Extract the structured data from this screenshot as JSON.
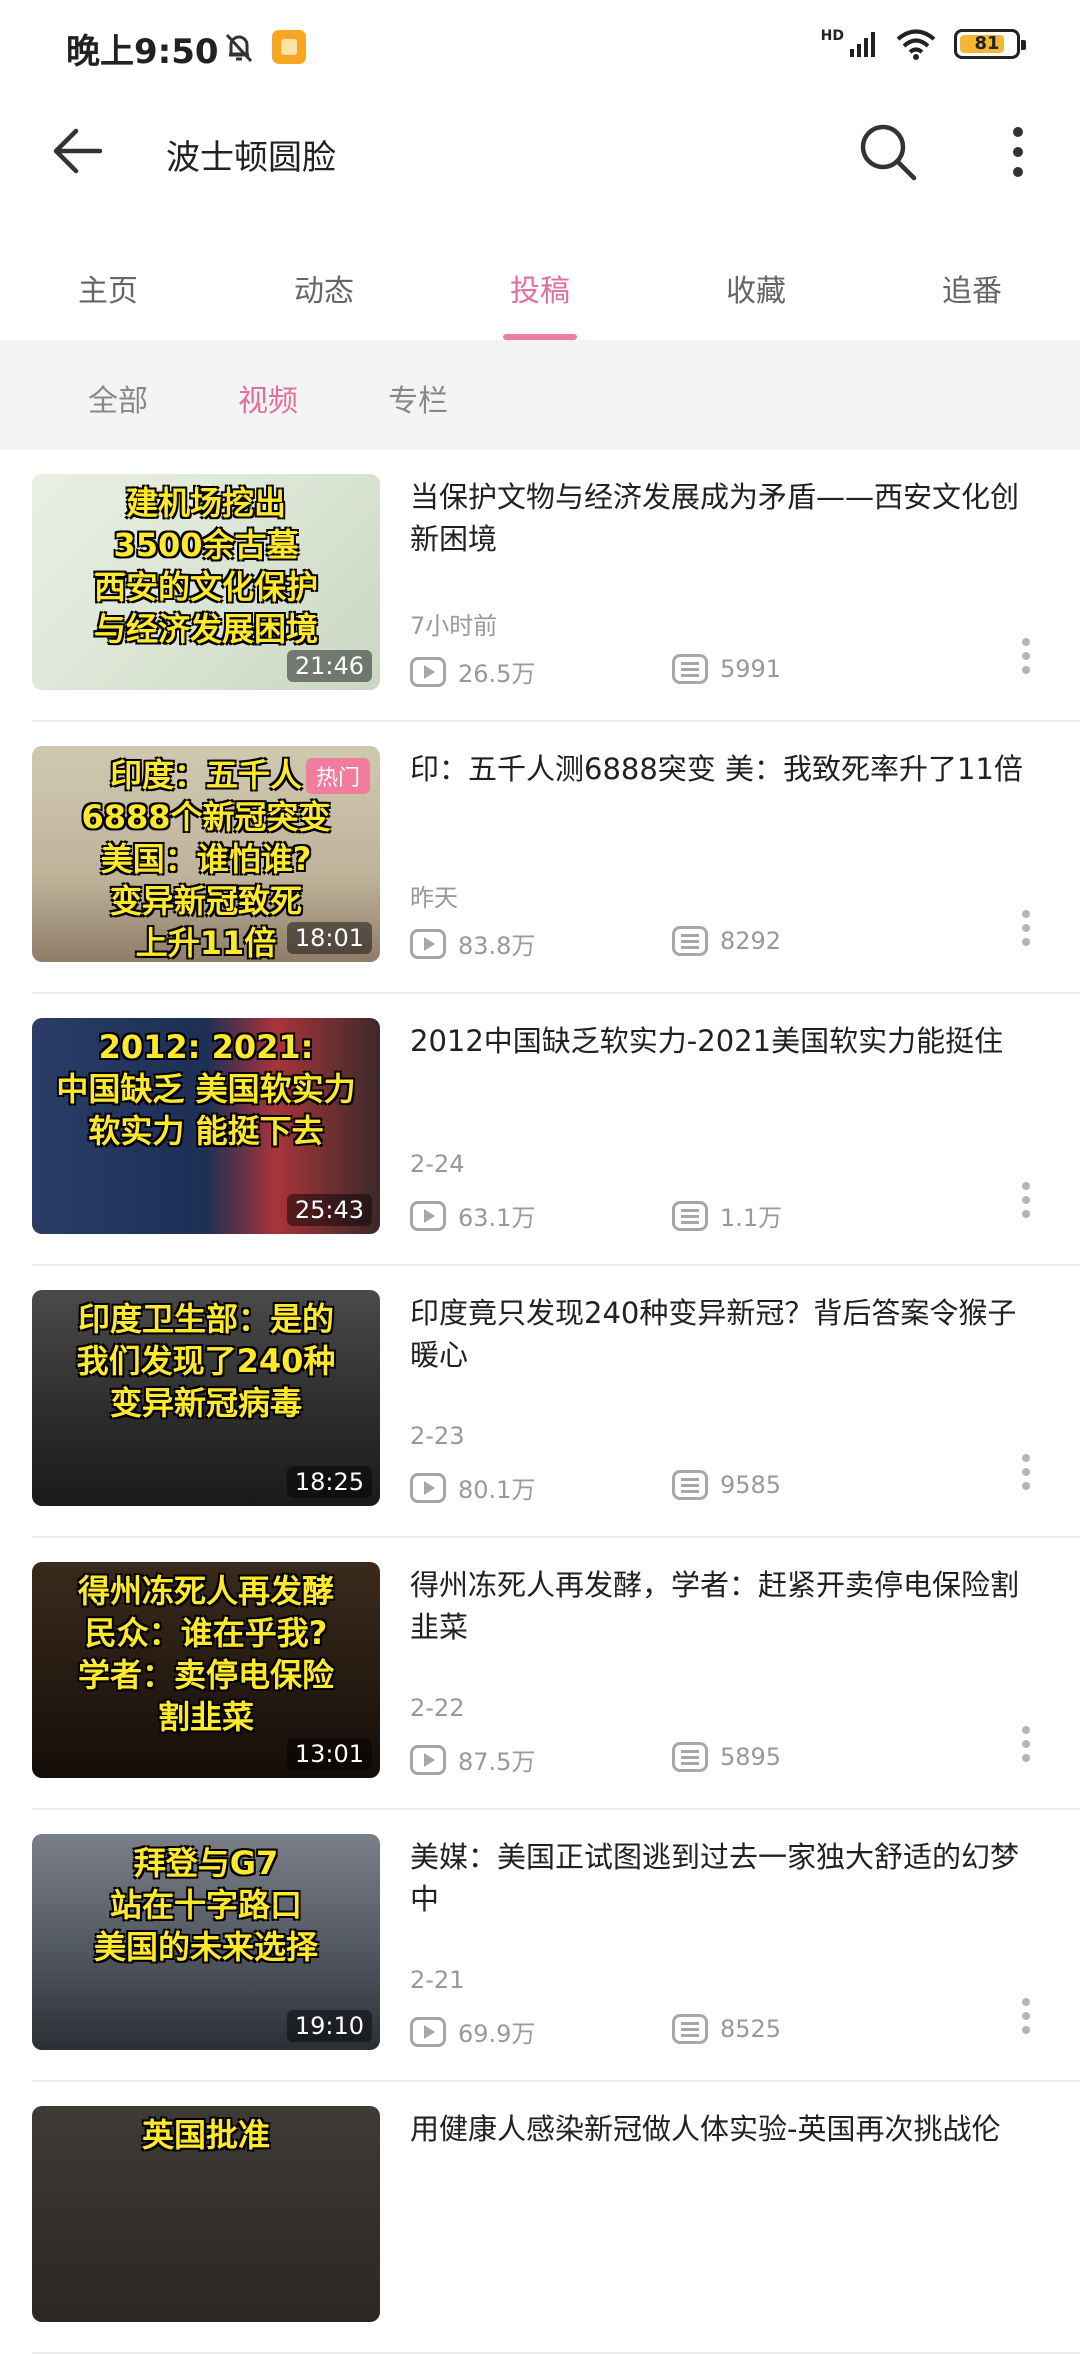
{
  "status": {
    "time": "晚上9:50",
    "network": "HD",
    "battery": "81"
  },
  "header": {
    "title": "波士顿圆脸"
  },
  "tabs": [
    {
      "label": "主页"
    },
    {
      "label": "动态"
    },
    {
      "label": "投稿"
    },
    {
      "label": "收藏"
    },
    {
      "label": "追番"
    }
  ],
  "active_tab": "投稿",
  "subtabs": [
    {
      "label": "全部"
    },
    {
      "label": "视频"
    },
    {
      "label": "专栏"
    }
  ],
  "active_subtab": "视频",
  "colors": {
    "accent": "#e2709a",
    "subtab_bg": "#f4f4f4",
    "meta": "#999999"
  },
  "videos": [
    {
      "title": "当保护文物与经济发展成为矛盾——西安文化创新困境",
      "date": "7小时前",
      "views": "26.5万",
      "danmaku": "5991",
      "duration": "21:46",
      "caption": "建机场挖出\n3500余古墓\n西安的文化保护\n与经济发展困境",
      "badge": ""
    },
    {
      "title": "印：五千人测6888突变 美：我致死率升了11倍",
      "date": "昨天",
      "views": "83.8万",
      "danmaku": "8292",
      "duration": "18:01",
      "caption": "印度：五千人\n6888个新冠突变\n美国：谁怕谁?\n变异新冠致死\n上升11倍",
      "badge": "热门"
    },
    {
      "title": "2012中国缺乏软实力-2021美国软实力能挺住",
      "date": "2-24",
      "views": "63.1万",
      "danmaku": "1.1万",
      "duration": "25:43",
      "caption": "2012:       2021:\n中国缺乏  美国软实力\n软实力        能挺下去",
      "badge": ""
    },
    {
      "title": "印度竟只发现240种变异新冠？背后答案令猴子暖心",
      "date": "2-23",
      "views": "80.1万",
      "danmaku": "9585",
      "duration": "18:25",
      "caption": "印度卫生部：是的\n我们发现了240种\n变异新冠病毒",
      "badge": ""
    },
    {
      "title": "得州冻死人再发酵，学者：赶紧开卖停电保险割韭菜",
      "date": "2-22",
      "views": "87.5万",
      "danmaku": "5895",
      "duration": "13:01",
      "caption": "得州冻死人再发酵\n民众：谁在乎我?\n学者：卖停电保险\n割韭菜",
      "badge": ""
    },
    {
      "title": "美媒：美国正试图逃到过去一家独大舒适的幻梦中",
      "date": "2-21",
      "views": "69.9万",
      "danmaku": "8525",
      "duration": "19:10",
      "caption": "拜登与G7\n站在十字路口\n美国的未来选择",
      "badge": ""
    },
    {
      "title": "用健康人感染新冠做人体实验-英国再次挑战伦",
      "date": "",
      "views": "",
      "danmaku": "",
      "duration": "",
      "caption": "英国批准",
      "badge": ""
    }
  ]
}
